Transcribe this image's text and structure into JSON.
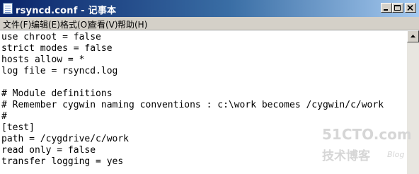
{
  "window": {
    "title": "rsyncd.conf - 记事本",
    "icon": "notepad-icon",
    "controls": [
      "minimize-icon",
      "maximize-icon",
      "close-icon"
    ]
  },
  "menu": [
    "文件(F)",
    "编辑(E)",
    "格式(O)",
    "查看(V)",
    "帮助(H)"
  ],
  "editor": {
    "lines": [
      "use chroot = false",
      "strict modes = false",
      "hosts allow = *",
      "log file = rsyncd.log",
      "",
      "# Module definitions",
      "# Remember cygwin naming conventions : c:\\work becomes /cygwin/c/work",
      "#",
      "[test]",
      "path = /cygdrive/c/work",
      "read only = false",
      "transfer logging = yes"
    ]
  },
  "watermark": {
    "main": "51CTO.com",
    "sub": "技术博客",
    "blog": "Blog"
  },
  "colors": {
    "titlebar_start": "#0a246a",
    "titlebar_end": "#a6caf0",
    "chrome": "#d4d0c8",
    "text": "#000000",
    "watermark": "#d6d6d6"
  }
}
